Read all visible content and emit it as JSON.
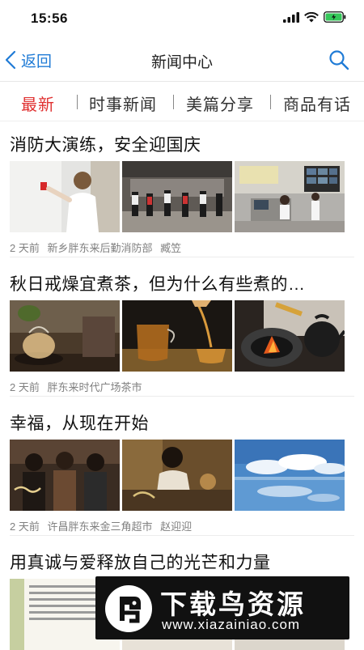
{
  "status_bar": {
    "time": "15:56"
  },
  "nav": {
    "back_label": "返回",
    "title": "新闻中心"
  },
  "tabs": [
    {
      "label": "最新",
      "active": true
    },
    {
      "label": "时事新闻",
      "active": false
    },
    {
      "label": "美篇分享",
      "active": false
    },
    {
      "label": "商品有话",
      "active": false
    }
  ],
  "articles": [
    {
      "title": "消防大演练，安全迎国庆",
      "time": "2 天前",
      "source": "新乡胖东来后勤消防部",
      "author": "臧笠"
    },
    {
      "title": "秋日戒燥宜煮茶，但为什么有些煮的…",
      "time": "2 天前",
      "source": "胖东来时代广场茶市",
      "author": ""
    },
    {
      "title": "幸福，从现在开始",
      "time": "2 天前",
      "source": "许昌胖东来金三角超市",
      "author": "赵迎迎"
    },
    {
      "title": "用真诚与爱释放自己的光芒和力量",
      "time": "",
      "source": "",
      "author": ""
    }
  ],
  "watermark": {
    "title": "下载鸟资源",
    "url": "www.xiazainiao.com"
  },
  "colors": {
    "accent": "#e03131",
    "nav_blue": "#1f7bd6"
  }
}
